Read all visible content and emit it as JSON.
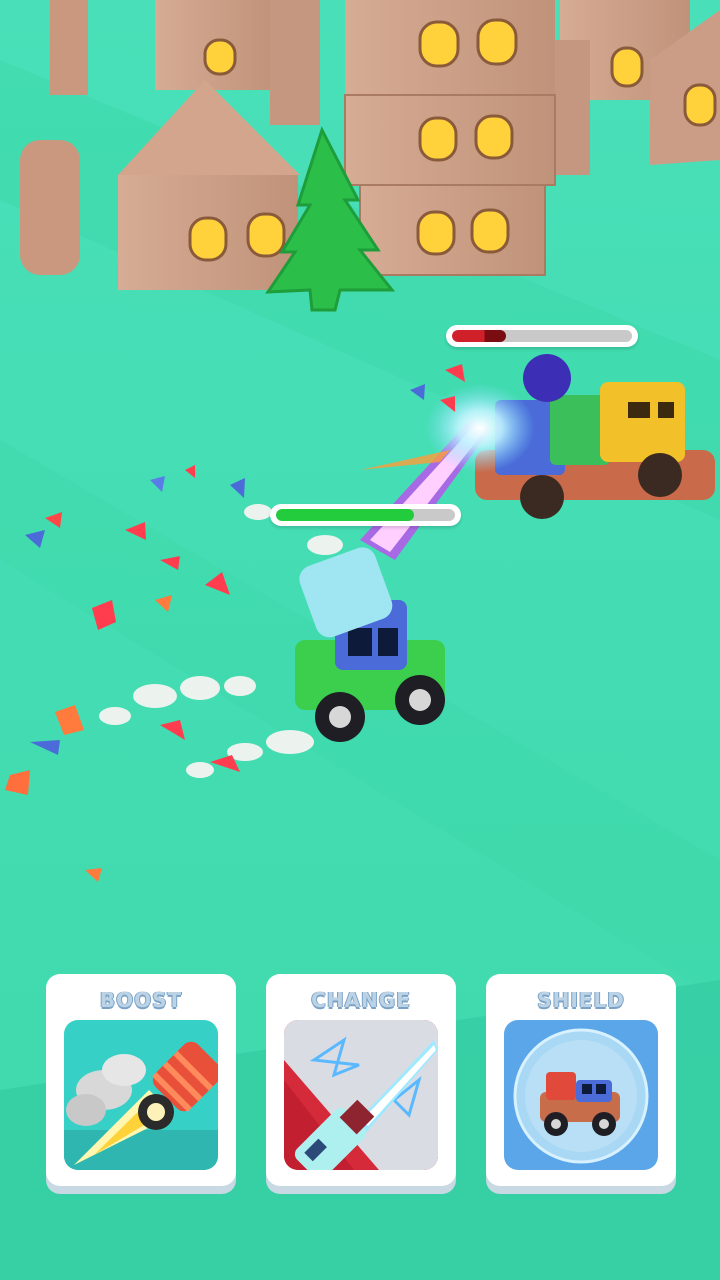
{
  "player": {
    "health": 0.77,
    "bar_color": "#22cc3c"
  },
  "enemy": {
    "health": 0.3,
    "bar_colors": [
      "#d0202a",
      "#7a0c12"
    ]
  },
  "abilities": [
    {
      "label": "BOOST",
      "icon": "rocket-boost-icon",
      "accent": "#36d0c7"
    },
    {
      "label": "CHANGE",
      "icon": "laser-weapon-icon",
      "accent": "#d52a3a"
    },
    {
      "label": "SHIELD",
      "icon": "bubble-shield-icon",
      "accent": "#5aa6e8"
    }
  ],
  "colors": {
    "ground": "#41e3b4",
    "road": "#3fd9a9",
    "card": "#ffffff"
  }
}
